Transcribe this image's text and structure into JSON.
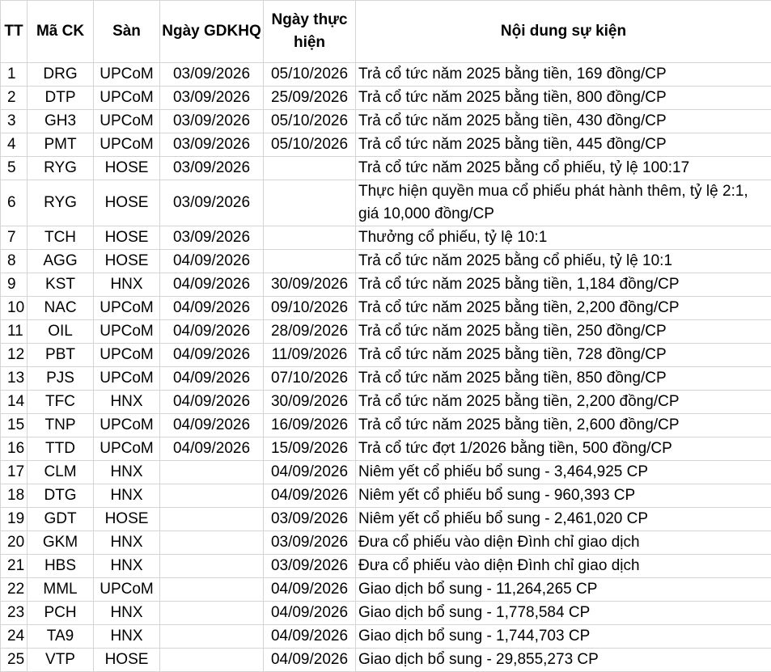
{
  "table": {
    "headers": {
      "tt": "TT",
      "ma_ck": "Mã CK",
      "san": "Sàn",
      "ngay_gdkhq": "Ngày GDKHQ",
      "ngay_thuc_hien": "Ngày thực hiện",
      "noi_dung": "Nội dung sự kiện"
    },
    "rows": [
      {
        "tt": "1",
        "ma": "DRG",
        "san": "UPCoM",
        "gdkhq": "03/09/2026",
        "th": "05/10/2026",
        "nd": "Trả cổ tức năm 2025 bằng tiền, 169 đồng/CP"
      },
      {
        "tt": "2",
        "ma": "DTP",
        "san": "UPCoM",
        "gdkhq": "03/09/2026",
        "th": "25/09/2026",
        "nd": "Trả cổ tức năm 2025 bằng tiền, 800 đồng/CP"
      },
      {
        "tt": "3",
        "ma": "GH3",
        "san": "UPCoM",
        "gdkhq": "03/09/2026",
        "th": "05/10/2026",
        "nd": "Trả cổ tức năm 2025 bằng tiền, 430 đồng/CP"
      },
      {
        "tt": "4",
        "ma": "PMT",
        "san": "UPCoM",
        "gdkhq": "03/09/2026",
        "th": "05/10/2026",
        "nd": "Trả cổ tức năm 2025 bằng tiền, 445 đồng/CP"
      },
      {
        "tt": "5",
        "ma": "RYG",
        "san": "HOSE",
        "gdkhq": "03/09/2026",
        "th": "",
        "nd": "Trả cổ tức năm 2025 bằng cổ phiếu, tỷ lệ 100:17"
      },
      {
        "tt": "6",
        "ma": "RYG",
        "san": "HOSE",
        "gdkhq": "03/09/2026",
        "th": "",
        "nd": "Thực hiện quyền mua cổ phiếu phát hành thêm, tỷ lệ 2:1, giá 10,000 đồng/CP"
      },
      {
        "tt": "7",
        "ma": "TCH",
        "san": "HOSE",
        "gdkhq": "03/09/2026",
        "th": "",
        "nd": "Thưởng cổ phiếu, tỷ lệ 10:1"
      },
      {
        "tt": "8",
        "ma": "AGG",
        "san": "HOSE",
        "gdkhq": "04/09/2026",
        "th": "",
        "nd": "Trả cổ tức năm 2025 bằng cổ phiếu, tỷ lệ 10:1"
      },
      {
        "tt": "9",
        "ma": "KST",
        "san": "HNX",
        "gdkhq": "04/09/2026",
        "th": "30/09/2026",
        "nd": "Trả cổ tức năm 2025 bằng tiền, 1,184 đồng/CP"
      },
      {
        "tt": "10",
        "ma": "NAC",
        "san": "UPCoM",
        "gdkhq": "04/09/2026",
        "th": "09/10/2026",
        "nd": "Trả cổ tức năm 2025 bằng tiền, 2,200 đồng/CP"
      },
      {
        "tt": "11",
        "ma": "OIL",
        "san": "UPCoM",
        "gdkhq": "04/09/2026",
        "th": "28/09/2026",
        "nd": "Trả cổ tức năm 2025 bằng tiền, 250 đồng/CP"
      },
      {
        "tt": "12",
        "ma": "PBT",
        "san": "UPCoM",
        "gdkhq": "04/09/2026",
        "th": "11/09/2026",
        "nd": "Trả cổ tức năm 2025 bằng tiền, 728 đồng/CP"
      },
      {
        "tt": "13",
        "ma": "PJS",
        "san": "UPCoM",
        "gdkhq": "04/09/2026",
        "th": "07/10/2026",
        "nd": "Trả cổ tức năm 2025 bằng tiền, 850 đồng/CP"
      },
      {
        "tt": "14",
        "ma": "TFC",
        "san": "HNX",
        "gdkhq": "04/09/2026",
        "th": "30/09/2026",
        "nd": "Trả cổ tức năm 2025 bằng tiền, 2,200 đồng/CP"
      },
      {
        "tt": "15",
        "ma": "TNP",
        "san": "UPCoM",
        "gdkhq": "04/09/2026",
        "th": "16/09/2026",
        "nd": "Trả cổ tức năm 2025 bằng tiền, 2,600 đồng/CP"
      },
      {
        "tt": "16",
        "ma": "TTD",
        "san": "UPCoM",
        "gdkhq": "04/09/2026",
        "th": "15/09/2026",
        "nd": "Trả cổ tức đợt 1/2026 bằng tiền, 500 đồng/CP"
      },
      {
        "tt": "17",
        "ma": "CLM",
        "san": "HNX",
        "gdkhq": "",
        "th": "04/09/2026",
        "nd": "Niêm yết cổ phiếu bổ sung - 3,464,925 CP"
      },
      {
        "tt": "18",
        "ma": "DTG",
        "san": "HNX",
        "gdkhq": "",
        "th": "04/09/2026",
        "nd": "Niêm yết cổ phiếu bổ sung - 960,393 CP"
      },
      {
        "tt": "19",
        "ma": "GDT",
        "san": "HOSE",
        "gdkhq": "",
        "th": "03/09/2026",
        "nd": "Niêm yết cổ phiếu bổ sung - 2,461,020 CP"
      },
      {
        "tt": "20",
        "ma": "GKM",
        "san": "HNX",
        "gdkhq": "",
        "th": "03/09/2026",
        "nd": "Đưa cổ phiếu vào diện Đình chỉ giao dịch"
      },
      {
        "tt": "21",
        "ma": "HBS",
        "san": "HNX",
        "gdkhq": "",
        "th": "03/09/2026",
        "nd": "Đưa cổ phiếu vào diện Đình chỉ giao dịch"
      },
      {
        "tt": "22",
        "ma": "MML",
        "san": "UPCoM",
        "gdkhq": "",
        "th": "04/09/2026",
        "nd": "Giao dịch bổ sung - 11,264,265 CP"
      },
      {
        "tt": "23",
        "ma": "PCH",
        "san": "HNX",
        "gdkhq": "",
        "th": "04/09/2026",
        "nd": "Giao dịch bổ sung - 1,778,584 CP"
      },
      {
        "tt": "24",
        "ma": "TA9",
        "san": "HNX",
        "gdkhq": "",
        "th": "04/09/2026",
        "nd": "Giao dịch bổ sung - 1,744,703 CP"
      },
      {
        "tt": "25",
        "ma": "VTP",
        "san": "HOSE",
        "gdkhq": "",
        "th": "04/09/2026",
        "nd": "Giao dịch bổ sung - 29,855,273 CP"
      }
    ]
  }
}
